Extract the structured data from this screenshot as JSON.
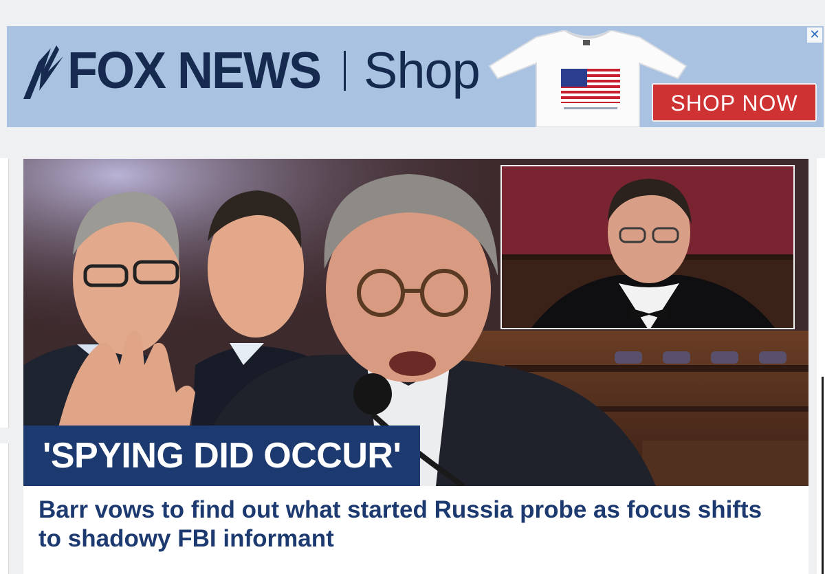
{
  "ad": {
    "brand": "FOX NEWS",
    "section": "Shop",
    "cta": "SHOP NOW",
    "close_glyph": "✕",
    "colors": {
      "banner": "#a9c2e2",
      "brand": "#16294f",
      "cta": "#cf3232"
    }
  },
  "story": {
    "kicker": "'SPYING DID OCCUR'",
    "headline": "Barr vows to find out what started Russia probe as focus shifts to shadowy FBI informant",
    "colors": {
      "kicker_bg": "#1d3a70",
      "headline": "#1d3a70"
    }
  }
}
